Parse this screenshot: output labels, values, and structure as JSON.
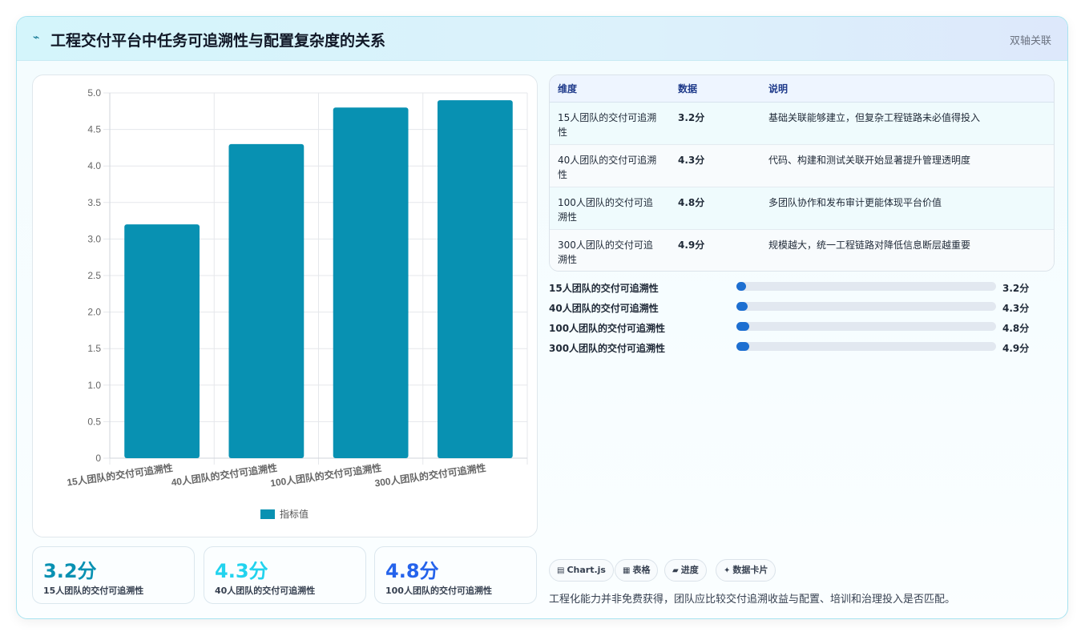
{
  "header": {
    "icon": "pulse-icon",
    "title": "工程交付平台中任务可追溯性与配置复杂度的关系",
    "tag": "双轴关联"
  },
  "chart_data": {
    "type": "bar",
    "categories": [
      "15人团队的交付可追溯性",
      "40人团队的交付可追溯性",
      "100人团队的交付可追溯性",
      "300人团队的交付可追溯性"
    ],
    "series": [
      {
        "name": "指标值",
        "values": [
          3.2,
          4.3,
          4.8,
          4.9
        ],
        "color": "#0891b2"
      }
    ],
    "ylim": [
      0,
      5.0
    ],
    "yticks": [
      "0",
      "0.5",
      "1.0",
      "1.5",
      "2.0",
      "2.5",
      "3.0",
      "3.5",
      "4.0",
      "4.5",
      "5.0"
    ],
    "grid": true,
    "legend": "bottom",
    "xlabel": "",
    "ylabel": "",
    "title": ""
  },
  "table": {
    "headers": [
      "维度",
      "数据",
      "说明"
    ],
    "rows": [
      {
        "dim": "15人团队的交付可追溯性",
        "value": "3.2分",
        "desc": "基础关联能够建立，但复杂工程链路未必值得投入"
      },
      {
        "dim": "40人团队的交付可追溯性",
        "value": "4.3分",
        "desc": "代码、构建和测试关联开始显著提升管理透明度"
      },
      {
        "dim": "100人团队的交付可追溯性",
        "value": "4.8分",
        "desc": "多团队协作和发布审计更能体现平台价值"
      },
      {
        "dim": "300人团队的交付可追溯性",
        "value": "4.9分",
        "desc": "规模越大，统一工程链路对降低信息断层越重要"
      }
    ]
  },
  "progress": [
    {
      "label": "15人团队的交付可追溯性",
      "value": "3.2分",
      "fraction": 0.032
    },
    {
      "label": "40人团队的交付可追溯性",
      "value": "4.3分",
      "fraction": 0.043
    },
    {
      "label": "100人团队的交付可追溯性",
      "value": "4.8分",
      "fraction": 0.048
    },
    {
      "label": "300人团队的交付可追溯性",
      "value": "4.9分",
      "fraction": 0.049
    }
  ],
  "stats": [
    {
      "value": "3.2分",
      "label": "15人团队的交付可追溯性",
      "color": "#0891b2"
    },
    {
      "value": "4.3分",
      "label": "40人团队的交付可追溯性",
      "color": "#22d3ee"
    },
    {
      "value": "4.8分",
      "label": "100人团队的交付可追溯性",
      "color": "#2563eb"
    }
  ],
  "chips": [
    {
      "icon": "chart-icon",
      "glyph": "▤",
      "label": "Chart.js"
    },
    {
      "icon": "table-icon",
      "glyph": "▦",
      "label": "表格"
    },
    {
      "icon": "progress-icon",
      "glyph": "▰",
      "label": "进度"
    },
    {
      "icon": "sparkle-icon",
      "glyph": "✦",
      "label": "数据卡片"
    }
  ],
  "note": "工程化能力并非免费获得，团队应比较交付追溯收益与配置、培训和治理投入是否匹配。"
}
